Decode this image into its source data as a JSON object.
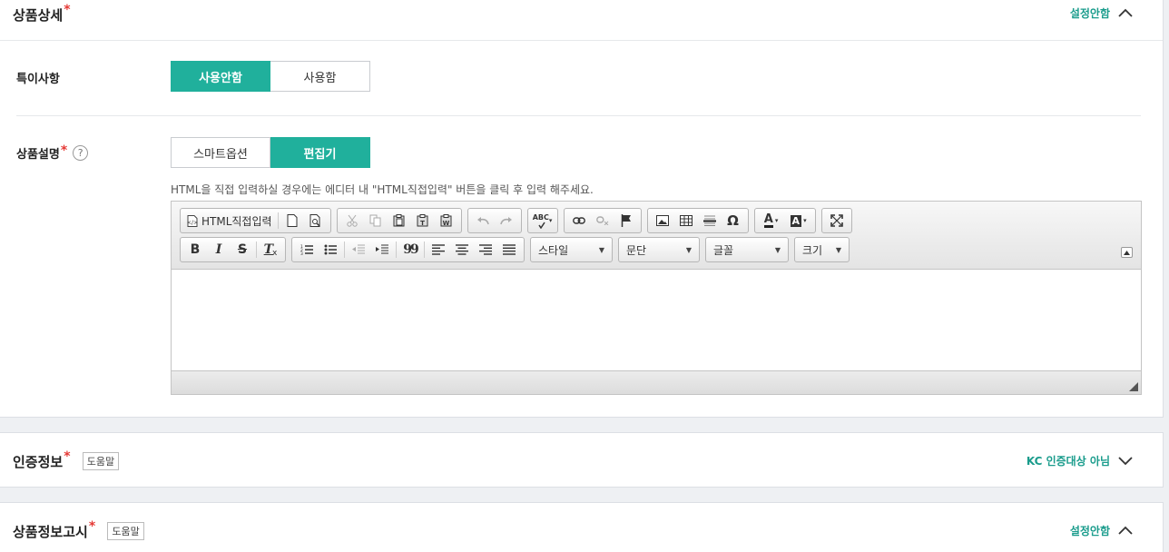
{
  "product_detail": {
    "title": "상품상세",
    "required_mark": "*",
    "status": "설정안함",
    "chevron_icon": "chevron-up-icon",
    "special_notes": {
      "label": "특이사항",
      "options": [
        "사용안함",
        "사용함"
      ],
      "selected": "사용안함"
    },
    "description": {
      "label": "상품설명",
      "required_mark": "*",
      "help_glyph": "?",
      "options": [
        "스마트옵션",
        "편집기"
      ],
      "selected": "편집기",
      "hint": "HTML을 직접 입력하실 경우에는 에디터 내 \"HTML직접입력\" 버튼을 클릭 후 입력 해주세요."
    },
    "editor": {
      "html_button": "HTML직접입력",
      "combos": {
        "style": "스타일",
        "paragraph": "문단",
        "font": "글꼴",
        "size": "크기"
      },
      "icons": {
        "new_page": "new-page-icon",
        "preview": "preview-icon",
        "cut": "cut-icon",
        "copy": "copy-icon",
        "paste": "paste-icon",
        "paste_text": "paste-text-icon",
        "paste_word": "paste-word-icon",
        "undo": "undo-icon",
        "redo": "redo-icon",
        "spellcheck": "spellcheck-icon",
        "link": "link-icon",
        "unlink": "unlink-icon",
        "anchor": "anchor-flag-icon",
        "image": "image-icon",
        "table": "table-icon",
        "hr": "horizontal-rule-icon",
        "special_char": "omega-icon",
        "text_color": "text-color-icon",
        "bg_color": "background-color-icon",
        "maximize": "maximize-icon"
      },
      "spell_label": "ABC",
      "omega": "Ω",
      "text_color_glyph": "A",
      "bg_color_glyph": "A",
      "bold": "B",
      "italic": "I",
      "strike": "S",
      "clear_format": "T",
      "quote": "99"
    }
  },
  "certification": {
    "title": "인증정보",
    "required_mark": "*",
    "help": "도움말",
    "status": "KC 인증대상 아님",
    "chevron_icon": "chevron-down-icon"
  },
  "product_notice": {
    "title": "상품정보고시",
    "required_mark": "*",
    "help": "도움말",
    "status": "설정안함",
    "chevron_icon": "chevron-up-icon"
  }
}
